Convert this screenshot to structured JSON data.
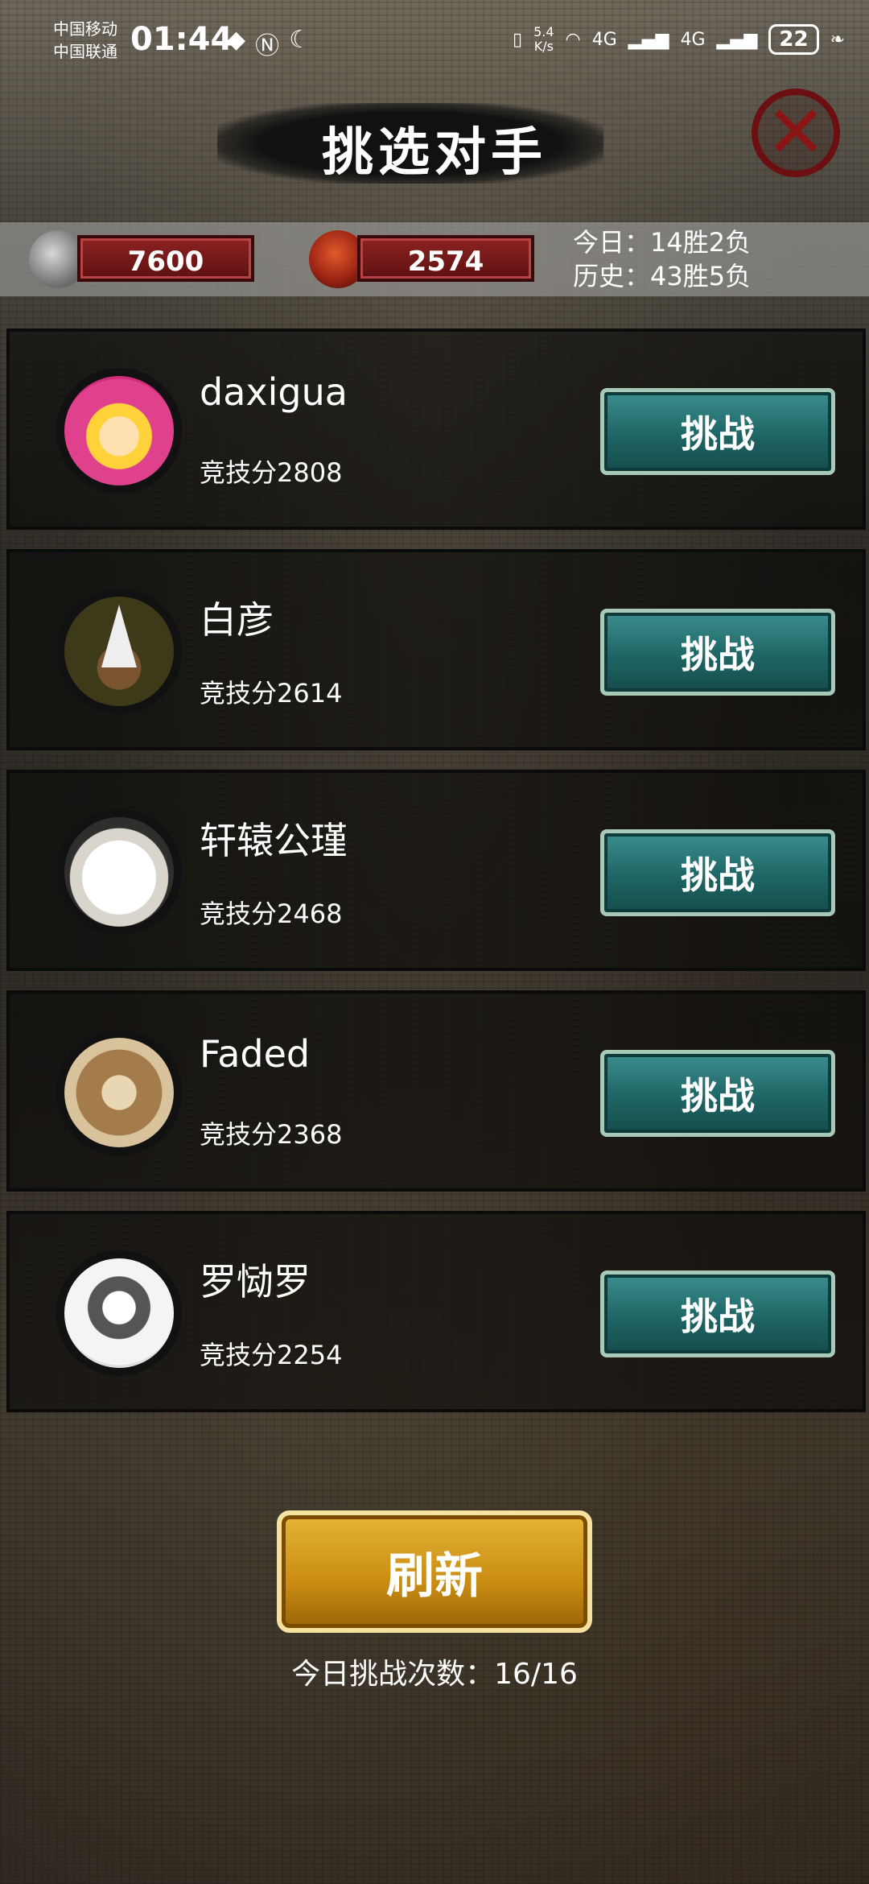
{
  "status_bar": {
    "carrier1": "中国移动",
    "carrier2": "中国联通",
    "time": "01:44",
    "net_speed_value": "5.4",
    "net_speed_unit": "K/s",
    "signal1": "4G",
    "signal2": "4G",
    "battery": "22"
  },
  "header": {
    "title": "挑选对手"
  },
  "resources": {
    "coins": "7600",
    "arena_points": "2574",
    "today_record": "今日：14胜2负",
    "history_record": "历史：43胜5负"
  },
  "opponents": [
    {
      "name": "daxigua",
      "score": "竞技分2808",
      "button": "挑战"
    },
    {
      "name": "白彦",
      "score": "竞技分2614",
      "button": "挑战"
    },
    {
      "name": "轩辕公瑾",
      "score": "竞技分2468",
      "button": "挑战"
    },
    {
      "name": "Faded",
      "score": "竞技分2368",
      "button": "挑战"
    },
    {
      "name": "罗恸罗",
      "score": "竞技分2254",
      "button": "挑战"
    }
  ],
  "footer": {
    "refresh_label": "刷新",
    "challenges_remaining": "今日挑战次数：16/16"
  }
}
